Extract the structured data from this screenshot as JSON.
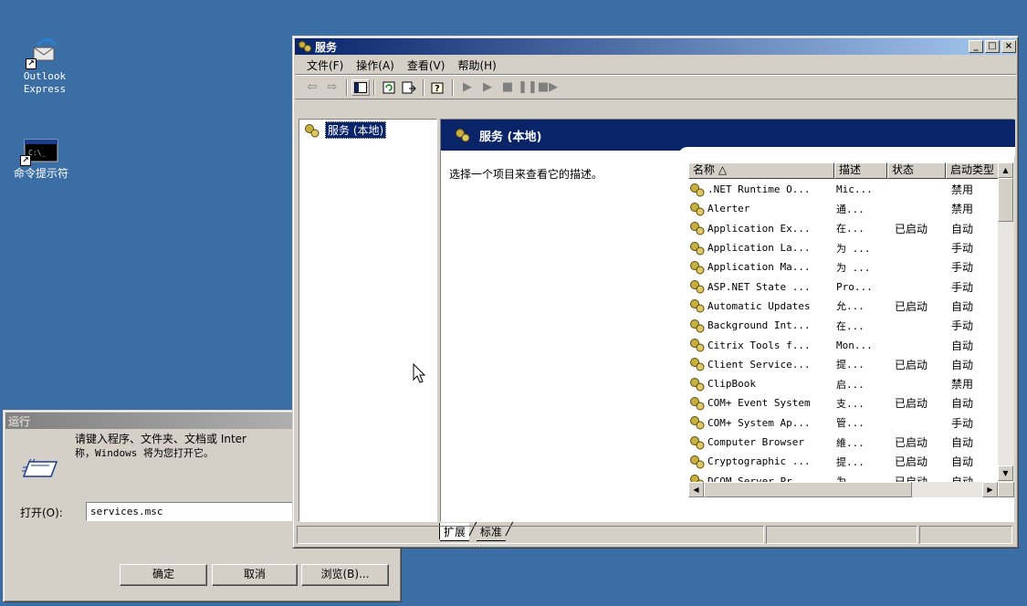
{
  "desktop": {
    "icons": [
      {
        "label": "Outlook\nExpress",
        "icon": "outlook-express-icon"
      },
      {
        "label": "命令提示符",
        "icon": "command-prompt-icon"
      }
    ]
  },
  "services_window": {
    "title": "服务",
    "menu": [
      "文件(F)",
      "操作(A)",
      "查看(V)",
      "帮助(H)"
    ],
    "toolbar_icons": [
      "back-arrow-icon",
      "forward-arrow-icon",
      "show-hide-tree-icon",
      "refresh-icon",
      "export-list-icon",
      "help-icon",
      "start-service-icon",
      "start-service-alt-icon",
      "stop-service-icon",
      "pause-service-icon",
      "restart-service-icon"
    ],
    "tree_item": "服务 (本地)",
    "banner_title": "服务 (本地)",
    "description_prompt": "选择一个项目来查看它的描述。",
    "columns": [
      "名称 △",
      "描述",
      "状态",
      "启动类型"
    ],
    "rows": [
      {
        "name": ".NET Runtime O...",
        "desc": "Mic...",
        "status": "",
        "startup": "禁用"
      },
      {
        "name": "Alerter",
        "desc": "通...",
        "status": "",
        "startup": "禁用"
      },
      {
        "name": "Application Ex...",
        "desc": "在...",
        "status": "已启动",
        "startup": "自动"
      },
      {
        "name": "Application La...",
        "desc": "为 ...",
        "status": "",
        "startup": "手动"
      },
      {
        "name": "Application Ma...",
        "desc": "为 ...",
        "status": "",
        "startup": "手动"
      },
      {
        "name": "ASP.NET State ...",
        "desc": "Pro...",
        "status": "",
        "startup": "手动"
      },
      {
        "name": "Automatic Updates",
        "desc": "允...",
        "status": "已启动",
        "startup": "自动"
      },
      {
        "name": "Background Int...",
        "desc": "在...",
        "status": "",
        "startup": "手动"
      },
      {
        "name": "Citrix Tools f...",
        "desc": "Mon...",
        "status": "",
        "startup": "自动"
      },
      {
        "name": "Client Service...",
        "desc": "提...",
        "status": "已启动",
        "startup": "自动"
      },
      {
        "name": "ClipBook",
        "desc": "启...",
        "status": "",
        "startup": "禁用"
      },
      {
        "name": "COM+ Event System",
        "desc": "支...",
        "status": "已启动",
        "startup": "自动"
      },
      {
        "name": "COM+ System Ap...",
        "desc": "管...",
        "status": "",
        "startup": "手动"
      },
      {
        "name": "Computer Browser",
        "desc": "維...",
        "status": "已启动",
        "startup": "自动"
      },
      {
        "name": "Cryptographic ...",
        "desc": "提...",
        "status": "已启动",
        "startup": "自动"
      },
      {
        "name": "DCOM Server Pr...",
        "desc": "为 ...",
        "status": "已启动",
        "startup": "自动"
      }
    ],
    "tabs": [
      "扩展",
      "标准"
    ]
  },
  "run_dialog": {
    "title": "运行",
    "message_line1": "请键入程序、文件夹、文档或 Inter",
    "message_line2": "称，Windows 将为您打开它。",
    "open_label": "打开(O):",
    "open_value": "services.msc",
    "ok": "确定",
    "cancel": "取消",
    "browse": "浏览(B)..."
  }
}
